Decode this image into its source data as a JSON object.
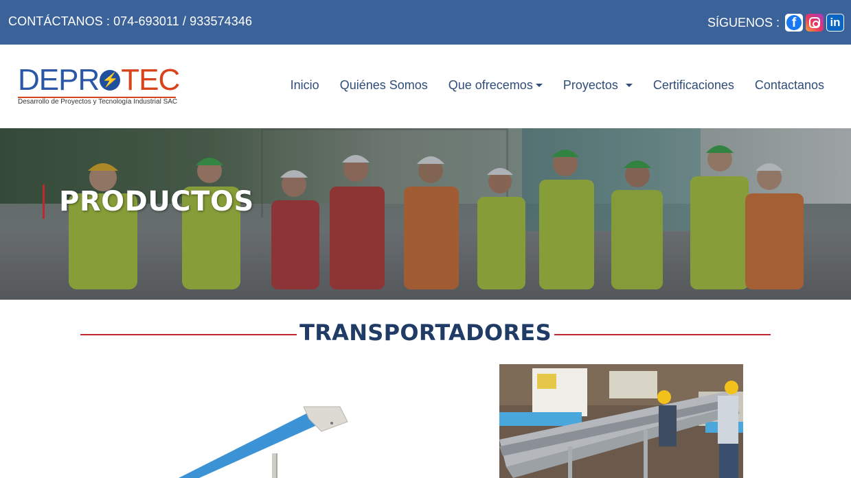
{
  "topbar": {
    "contact_text": "CONTÁCTANOS : 074-693011 / 933574346",
    "follow_label": "SÍGUENOS :",
    "social": [
      {
        "name": "facebook",
        "icon": "facebook-icon",
        "glyph": "f"
      },
      {
        "name": "instagram",
        "icon": "instagram-icon",
        "glyph": ""
      },
      {
        "name": "linkedin",
        "icon": "linkedin-icon",
        "glyph": "in"
      }
    ],
    "background_color": "#3c6399"
  },
  "logo": {
    "part1": "DEPR",
    "part2": "TEC",
    "tagline": "Desarrollo de Proyectos y Tecnología Industrial SAC",
    "bolt_glyph": "⚡"
  },
  "nav": {
    "items": [
      {
        "label": "Inicio",
        "dropdown": false
      },
      {
        "label": "Quiénes Somos",
        "dropdown": false
      },
      {
        "label": "Que ofrecemos",
        "dropdown": true
      },
      {
        "label": "Proyectos",
        "dropdown": true
      },
      {
        "label": "Certificaciones",
        "dropdown": false
      },
      {
        "label": "Contactanos",
        "dropdown": false
      }
    ]
  },
  "hero": {
    "title": "PRODUCTOS"
  },
  "section": {
    "heading": "TRANSPORTADORES"
  },
  "colors": {
    "accent_red": "#c0282d",
    "heading_blue": "#1f3b66",
    "nav_text": "#2f4d78"
  }
}
